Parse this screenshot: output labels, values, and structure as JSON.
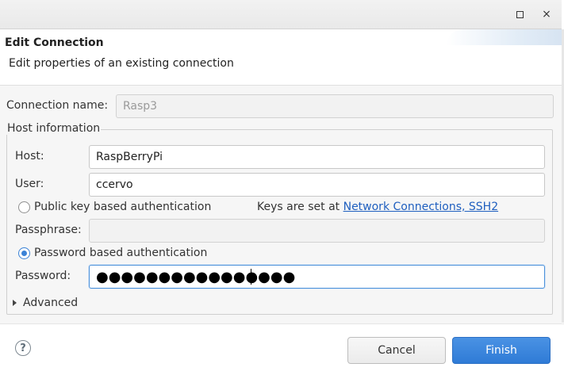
{
  "window": {
    "maximize_icon": "maximize-icon",
    "close_icon": "close-icon",
    "close_glyph": "×"
  },
  "header": {
    "title": "Edit Connection",
    "subtitle": "Edit properties of an existing connection"
  },
  "form": {
    "connection_name_label": "Connection name:",
    "connection_name_value": "Rasp3",
    "host_group_label": "Host information",
    "host_label": "Host:",
    "host_value": "RaspBerryPi",
    "user_label": "User:",
    "user_value": "ccervo",
    "public_key_label": "Public key based authentication",
    "public_key_selected": false,
    "keys_note_prefix": "Keys are set at",
    "keys_note_link": "Network Connections, SSH2",
    "passphrase_label": "Passphrase:",
    "passphrase_value": "",
    "password_auth_label": "Password based authentication",
    "password_auth_selected": true,
    "password_label": "Password:",
    "password_masked": "●●●●●●●●●●●●●●●●",
    "advanced_label": "Advanced"
  },
  "footer": {
    "help_glyph": "?",
    "cancel_label": "Cancel",
    "finish_label": "Finish"
  },
  "colors": {
    "accent": "#3b82d6",
    "finish_button": "#2f7bd6",
    "link": "#1f5fbf"
  }
}
